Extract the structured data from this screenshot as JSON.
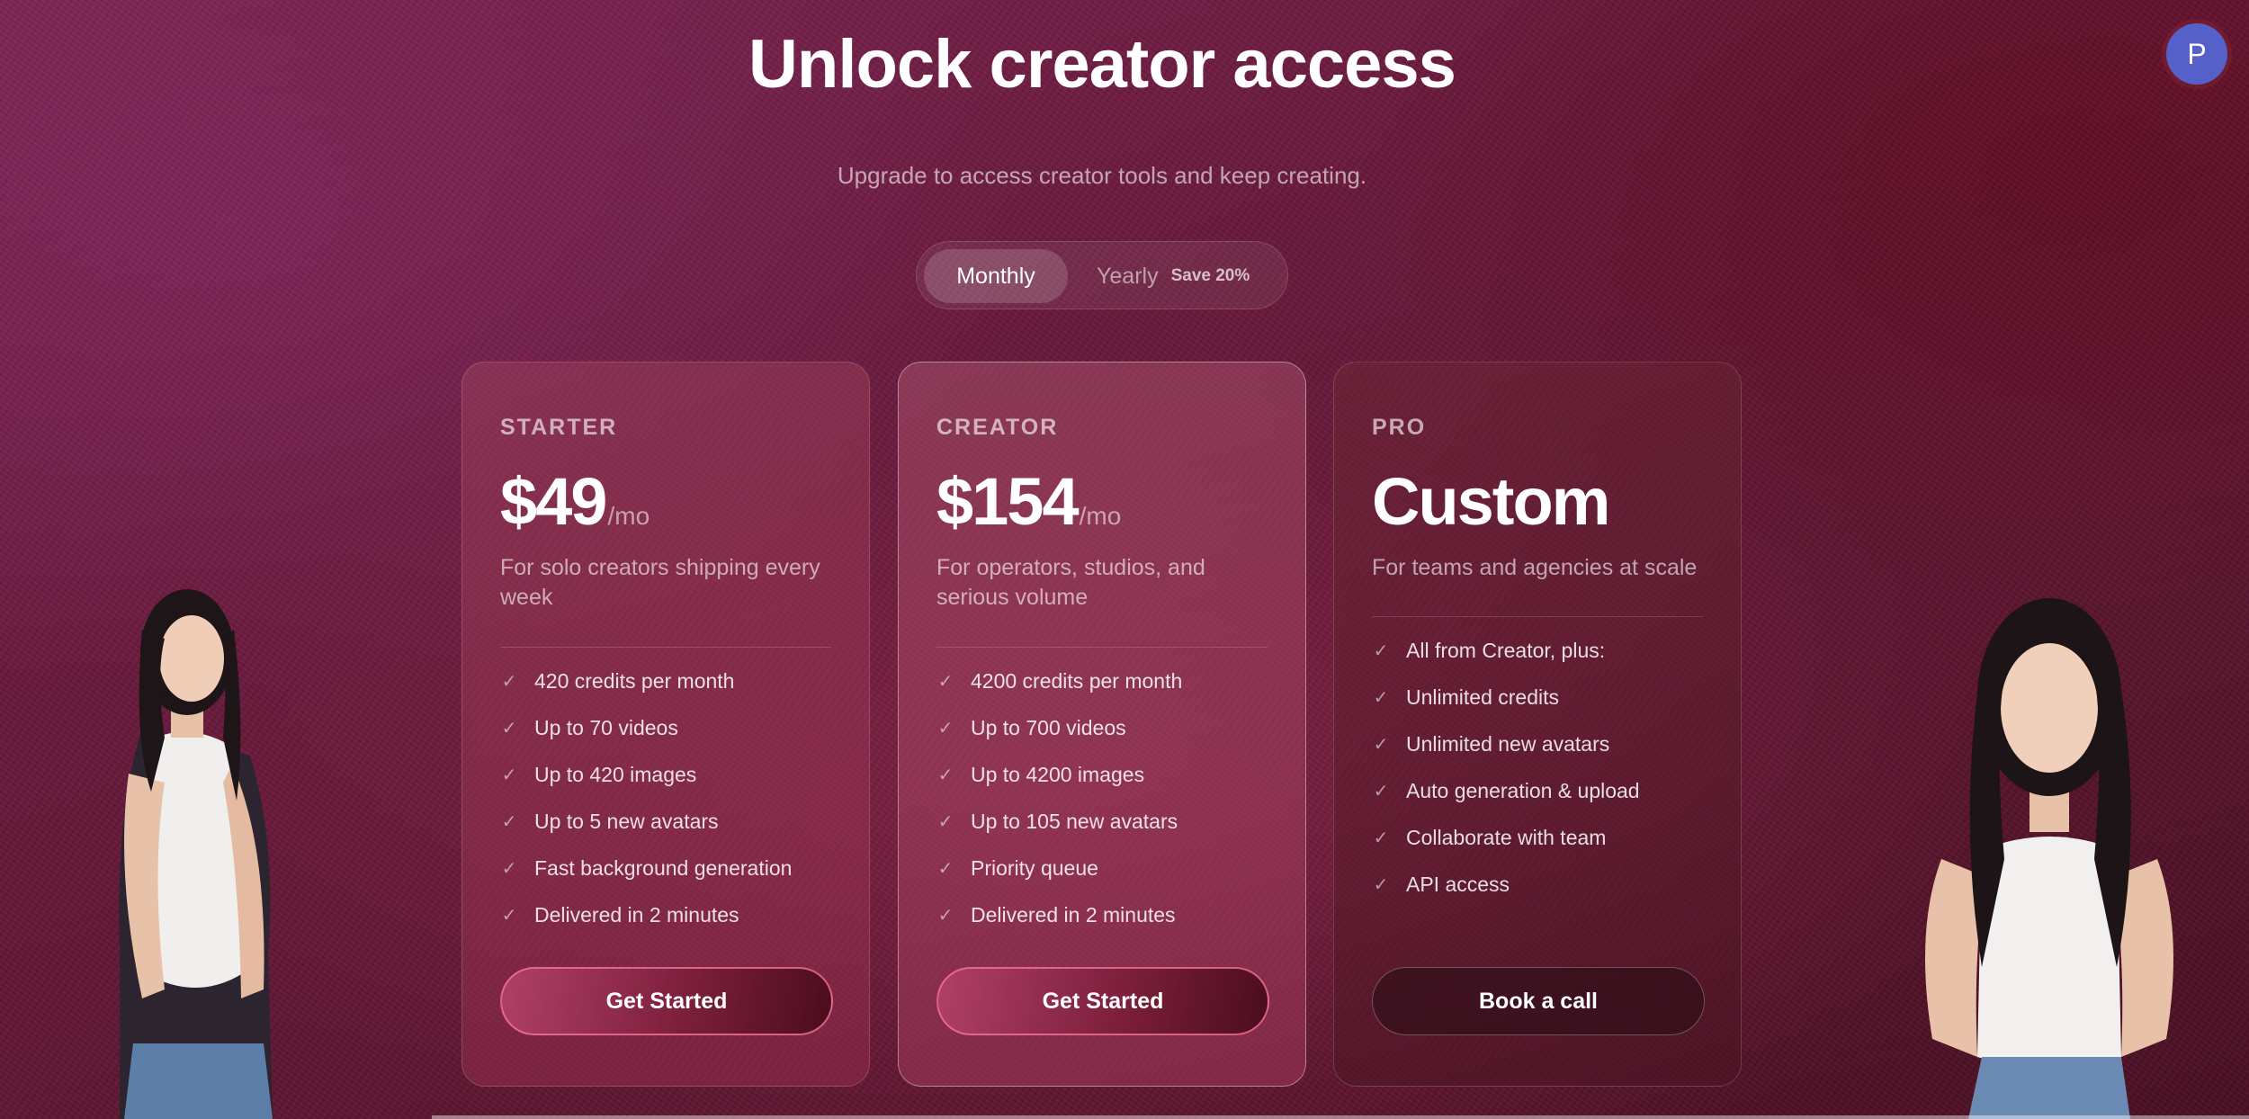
{
  "header": {
    "title": "Unlock creator access",
    "subtitle": "Upgrade to access creator tools and keep creating.",
    "avatar_initial": "P"
  },
  "billing_toggle": {
    "monthly_label": "Monthly",
    "yearly_label": "Yearly",
    "yearly_badge": "Save 20%",
    "selected": "Monthly"
  },
  "plans": [
    {
      "name": "STARTER",
      "price": "$49",
      "period": "/mo",
      "description": "For solo creators shipping every week",
      "features": [
        "420 credits per month",
        "Up to 70 videos",
        "Up to 420 images",
        "Up to 5 new avatars",
        "Fast background generation",
        "Delivered in 2 minutes"
      ],
      "button_label": "Get Started"
    },
    {
      "name": "CREATOR",
      "price": "$154",
      "period": "/mo",
      "description": "For operators, studios, and serious volume",
      "features": [
        "4200 credits per month",
        "Up to 700 videos",
        "Up to 4200 images",
        "Up to 105 new avatars",
        "Priority queue",
        "Delivered in 2 minutes"
      ],
      "button_label": "Get Started"
    },
    {
      "name": "PRO",
      "price": "Custom",
      "description": "For teams and agencies at scale",
      "features": [
        "All from Creator, plus:",
        "Unlimited credits",
        "Unlimited new avatars",
        "Auto generation & upload",
        "Collaborate with team",
        "API access"
      ],
      "button_label": "Book a call"
    }
  ],
  "icons": {
    "check": "check-icon",
    "check_glyph": "✓"
  }
}
